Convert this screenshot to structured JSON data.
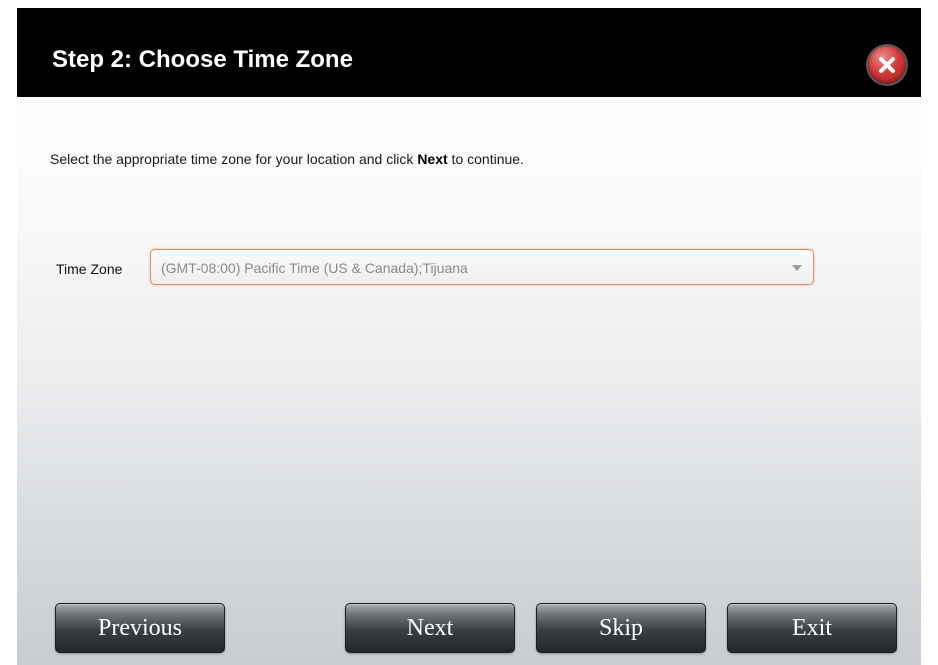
{
  "dialog": {
    "title": "Step 2: Choose Time Zone",
    "instruction": {
      "before": "Select the appropriate time zone for your location and click ",
      "bold": "Next",
      "after": " to continue."
    },
    "time_zone": {
      "label": "Time Zone",
      "selected": "(GMT-08:00) Pacific Time (US & Canada);Tijuana"
    },
    "buttons": {
      "previous": "Previous",
      "next": "Next",
      "skip": "Skip",
      "exit": "Exit"
    }
  },
  "icons": {
    "close": "close-icon",
    "dropdown": "chevron-down-icon"
  },
  "colors": {
    "header_bg": "#000000",
    "close_red": "#d23a3a",
    "select_border": "#e48a5c",
    "button_dark": "#23262a"
  }
}
